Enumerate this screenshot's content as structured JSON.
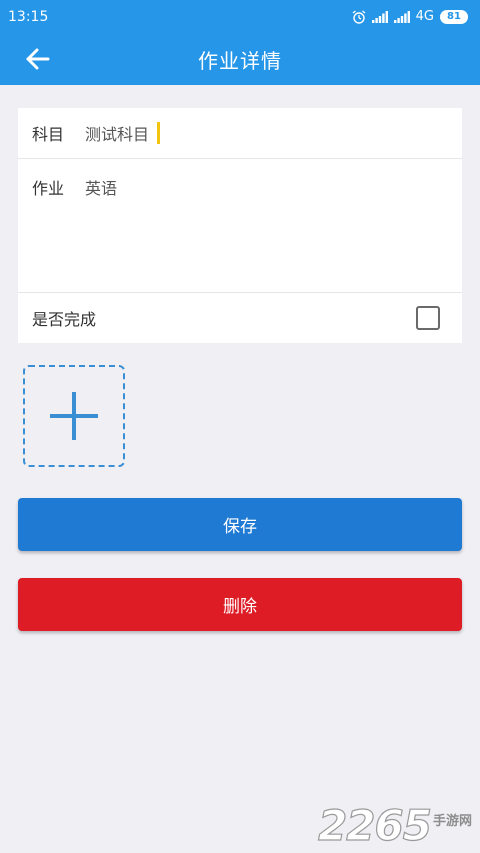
{
  "status_bar": {
    "time": "13:15",
    "network": "4G",
    "battery": "81"
  },
  "header": {
    "title": "作业详情"
  },
  "form": {
    "subject_label": "科目",
    "subject_value": "测试科目",
    "homework_label": "作业",
    "homework_value": "英语",
    "done_label": "是否完成",
    "done_checked": false
  },
  "buttons": {
    "save_label": "保存",
    "delete_label": "删除"
  },
  "watermark": {
    "number": "2265",
    "text": "手游网"
  },
  "colors": {
    "primary": "#2596e8",
    "save": "#1f7ad4",
    "delete": "#dd1c25",
    "background": "#efeff4"
  },
  "icons": {
    "back": "arrow-left-icon",
    "add": "plus-icon",
    "alarm": "alarm-icon",
    "signal": "signal-icon"
  }
}
